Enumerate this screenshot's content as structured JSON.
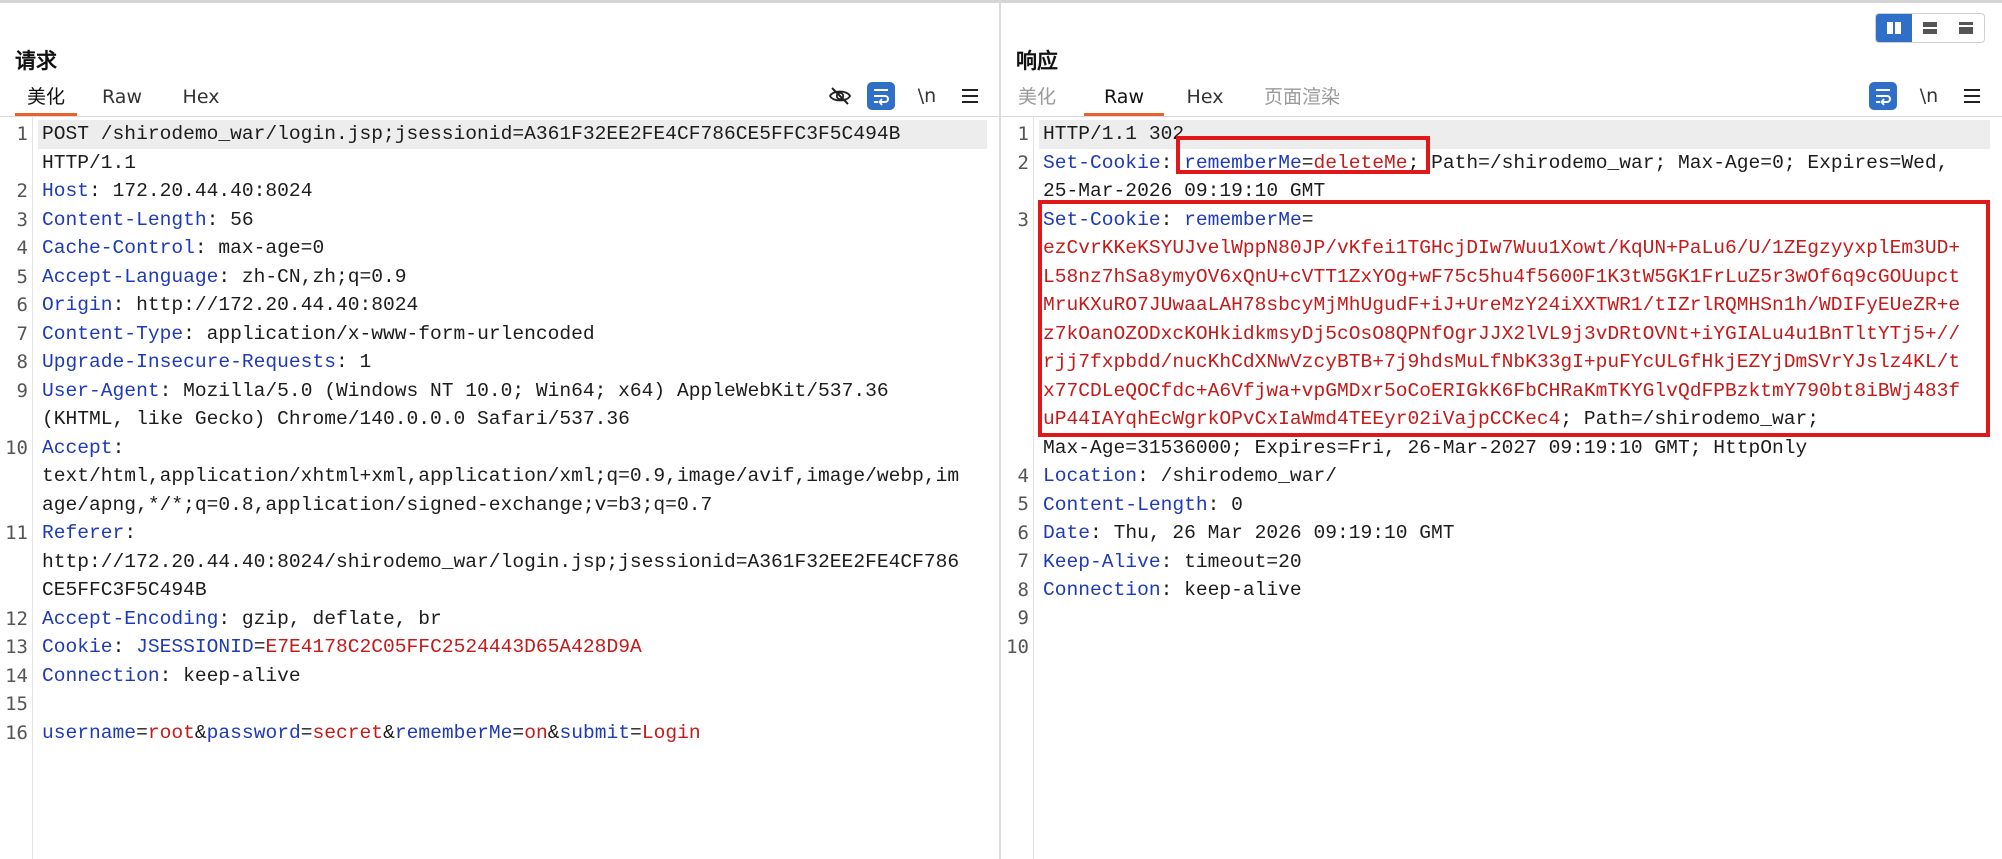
{
  "request": {
    "title": "请求",
    "tabs": [
      "美化",
      "Raw",
      "Hex"
    ],
    "active_tab": "美化",
    "toolbar": {
      "newline_label": "\\n"
    },
    "line_numbers": [
      "1",
      "2",
      "3",
      "4",
      "5",
      "6",
      "7",
      "8",
      "9",
      "10",
      "11",
      "12",
      "13",
      "14",
      "15",
      "16"
    ],
    "lines": [
      {
        "parts": [
          "POST /shirodemo_war/login.jsp;jsessionid=A361F32EE2FE4CF786CE5FFC3F5C494B"
        ]
      },
      {
        "parts": [
          "HTTP/1.1"
        ]
      },
      {
        "parts": [
          "Host",
          ": 172.20.44.40:8024"
        ]
      },
      {
        "parts": [
          "Content-Length",
          ": 56"
        ]
      },
      {
        "parts": [
          "Cache-Control",
          ": max-age=0"
        ]
      },
      {
        "parts": [
          "Accept-Language",
          ": zh-CN,zh;q=0.9"
        ]
      },
      {
        "parts": [
          "Origin",
          ": http://172.20.44.40:8024"
        ]
      },
      {
        "parts": [
          "Content-Type",
          ": application/x-www-form-urlencoded"
        ]
      },
      {
        "parts": [
          "Upgrade-Insecure-Requests",
          ": 1"
        ]
      },
      {
        "parts": [
          "User-Agent",
          ": Mozilla/5.0 (Windows NT 10.0; Win64; x64) AppleWebKit/537.36"
        ]
      },
      {
        "parts": [
          "(KHTML, like Gecko) Chrome/140.0.0.0 Safari/537.36"
        ]
      },
      {
        "parts": [
          "Accept",
          ":"
        ]
      },
      {
        "parts": [
          "text/html,application/xhtml+xml,application/xml;q=0.9,image/avif,image/webp,im"
        ]
      },
      {
        "parts": [
          "age/apng,*/*;q=0.8,application/signed-exchange;v=b3;q=0.7"
        ]
      },
      {
        "parts": [
          "Referer",
          ":"
        ]
      },
      {
        "parts": [
          "http://172.20.44.40:8024/shirodemo_war/login.jsp;jsessionid=A361F32EE2FE4CF786"
        ]
      },
      {
        "parts": [
          "CE5FFC3F5C494B"
        ]
      },
      {
        "parts": [
          "Accept-Encoding",
          ": gzip, deflate, br"
        ]
      },
      {
        "parts": [
          "Cookie",
          ": ",
          "JSESSIONID",
          "=",
          "E7E4178C2C05FFC2524443D65A428D9A"
        ]
      },
      {
        "parts": [
          "Connection",
          ": keep-alive"
        ]
      },
      {
        "parts": [
          ""
        ]
      },
      {
        "parts": [
          "username",
          "=",
          "root",
          "&",
          "password",
          "=",
          "secret",
          "&",
          "rememberMe",
          "=",
          "on",
          "&",
          "submit",
          "=",
          "Login"
        ]
      }
    ]
  },
  "response": {
    "title": "响应",
    "tabs": [
      "美化",
      "Raw",
      "Hex",
      "页面渲染"
    ],
    "active_tab": "Raw",
    "toolbar": {
      "newline_label": "\\n"
    },
    "line_numbers": [
      "1",
      "2",
      "3",
      "4",
      "5",
      "6",
      "7",
      "8",
      "9",
      "10"
    ],
    "lines": [
      {
        "parts": [
          "HTTP/1.1 302"
        ]
      },
      {
        "parts": [
          "Set-Cookie",
          ": ",
          "rememberMe",
          "=",
          "deleteMe",
          "; Path=/shirodemo_war; Max-Age=0; Expires=Wed,"
        ]
      },
      {
        "parts": [
          "25-Mar-2026 09:19:10 GMT"
        ]
      },
      {
        "parts": [
          "Set-Cookie",
          ": ",
          "rememberMe",
          "="
        ]
      },
      {
        "parts": [
          "ezCvrKKeKSYUJvelWppN80JP/vKfei1TGHcjDIw7Wuu1Xowt/KqUN+PaLu6/U/1ZEgzyyxplEm3UD+"
        ]
      },
      {
        "parts": [
          "L58nz7hSa8ymyOV6xQnU+cVTT1ZxYOg+wF75c5hu4f5600F1K3tW5GK1FrLuZ5r3wOf6q9cGOUupct"
        ]
      },
      {
        "parts": [
          "MruKXuRO7JUwaaLAH78sbcyMjMhUgudF+iJ+UreMzY24iXXTWR1/tIZrlRQMHSn1h/WDIFyEUeZR+e"
        ]
      },
      {
        "parts": [
          "z7kOanOZODxcKOHkidkmsyDj5cOsO8QPNfOgrJJX2lVL9j3vDRtOVNt+iYGIALu4u1BnTltYTj5+//"
        ]
      },
      {
        "parts": [
          "rjj7fxpbdd/nucKhCdXNwVzcyBTB+7j9hdsMuLfNbK33gI+puFYcULGfHkjEZYjDmSVrYJslz4KL/t"
        ]
      },
      {
        "parts": [
          "x77CDLeQOCfdc+A6Vfjwa+vpGMDxr5oCoERIGkK6FbCHRaKmTKYGlvQdFPBzktmY790bt8iBWj483f"
        ]
      },
      {
        "parts": [
          "uP44IAYqhEcWgrkOPvCxIaWmd4TEEyr02iVajpCCKec4",
          "; Path=/shirodemo_war;"
        ]
      },
      {
        "parts": [
          "Max-Age=31536000; Expires=Fri, 26-Mar-2027 09:19:10 GMT; HttpOnly"
        ]
      },
      {
        "parts": [
          "Location",
          ": /shirodemo_war/"
        ]
      },
      {
        "parts": [
          "Content-Length",
          ": 0"
        ]
      },
      {
        "parts": [
          "Date",
          ": Thu, 26 Mar 2026 09:19:10 GMT"
        ]
      },
      {
        "parts": [
          "Keep-Alive",
          ": timeout=20"
        ]
      },
      {
        "parts": [
          "Connection",
          ": keep-alive"
        ]
      },
      {
        "parts": [
          ""
        ]
      },
      {
        "parts": [
          ""
        ]
      }
    ]
  },
  "colors": {
    "key": "#1e3ab8",
    "value": "#c41a1a",
    "accent_tab": "#e8622f",
    "toolbar_active": "#2f6fc7",
    "highlight_box": "#e0171b"
  },
  "icons": {
    "request_toolbar": [
      "eye-slash-icon",
      "word-wrap-icon",
      "newline-icon",
      "menu-icon"
    ],
    "response_toolbar": [
      "word-wrap-icon",
      "newline-icon",
      "menu-icon"
    ],
    "layout": [
      "split-vertical-icon",
      "split-horizontal-icon",
      "single-pane-icon"
    ]
  }
}
